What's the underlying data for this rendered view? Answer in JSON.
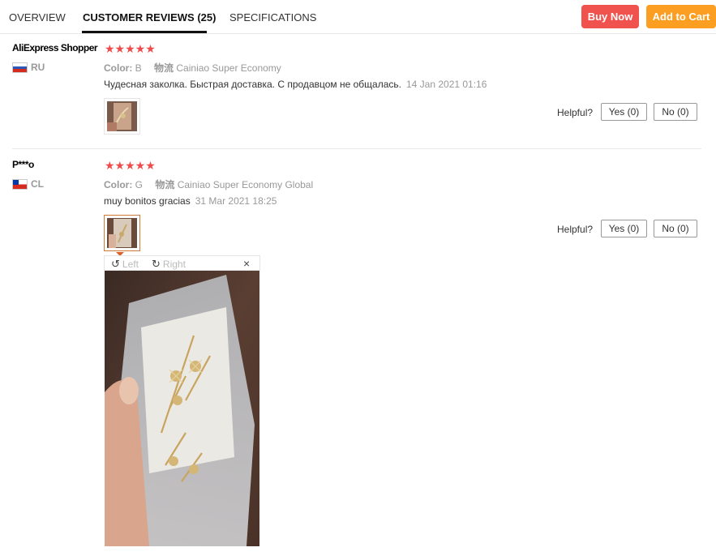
{
  "tabs": [
    {
      "label": "OVERVIEW"
    },
    {
      "label": "CUSTOMER REVIEWS (25)"
    },
    {
      "label": "SPECIFICATIONS"
    }
  ],
  "actions": {
    "buy_now": "Buy Now",
    "add_to_cart": "Add to Cart"
  },
  "reviews": [
    {
      "user": "AliExpress Shopper",
      "country": "RU",
      "stars": "★★★★★",
      "color_label": "Color:",
      "color_value": "B",
      "shipping_label": "物流",
      "shipping_value": "Cainiao Super Economy",
      "text": "Чудесная заколка. Быстрая доставка. С продавцом не общалась.",
      "date": "14 Jan 2021 01:16",
      "helpful_label": "Helpful?",
      "yes": "Yes (0)",
      "no": "No (0)"
    },
    {
      "user": "P***o",
      "country": "CL",
      "stars": "★★★★★",
      "color_label": "Color:",
      "color_value": "G",
      "shipping_label": "物流",
      "shipping_value": "Cainiao Super Economy Global",
      "text": "muy bonitos gracias",
      "date": "31 Mar 2021 18:25",
      "helpful_label": "Helpful?",
      "yes": "Yes (0)",
      "no": "No (0)"
    }
  ],
  "viewer": {
    "rotate_left": "Left",
    "rotate_right": "Right",
    "close": "×"
  },
  "icons": {
    "rotate_left": "↺",
    "rotate_right": "↻"
  },
  "colors": {
    "buy_now": "#f0524e",
    "add_to_cart": "#fb9e21",
    "stars": "#f04a4a"
  }
}
